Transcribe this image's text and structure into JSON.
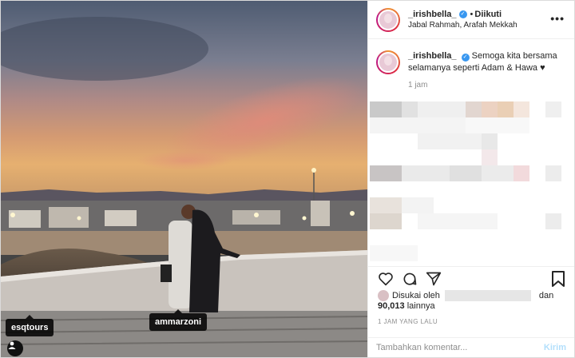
{
  "photo": {
    "tags": [
      "esqtours",
      "ammarzoni"
    ]
  },
  "header": {
    "username": "_irishbella_",
    "dot": "•",
    "follow_status": "Diikuti",
    "location": "Jabal Rahmah, Arafah Mekkah",
    "more_icon": "more-horizontal-icon"
  },
  "caption": {
    "username": "_irishbella_",
    "text": "Semoga kita bersama selamanya seperti Adam & Hawa ♥",
    "time": "1 jam"
  },
  "likes": {
    "prefix": "Disukai oleh",
    "and": "dan",
    "count": "90,013",
    "others": "lainnya"
  },
  "post_time": "1 JAM YANG LALU",
  "comment": {
    "placeholder": "Tambahkan komentar...",
    "submit": "Kirim"
  },
  "colors": {
    "verified": "#3897f0",
    "submit_disabled": "#b2dffc",
    "muted": "#8e8e8e"
  }
}
